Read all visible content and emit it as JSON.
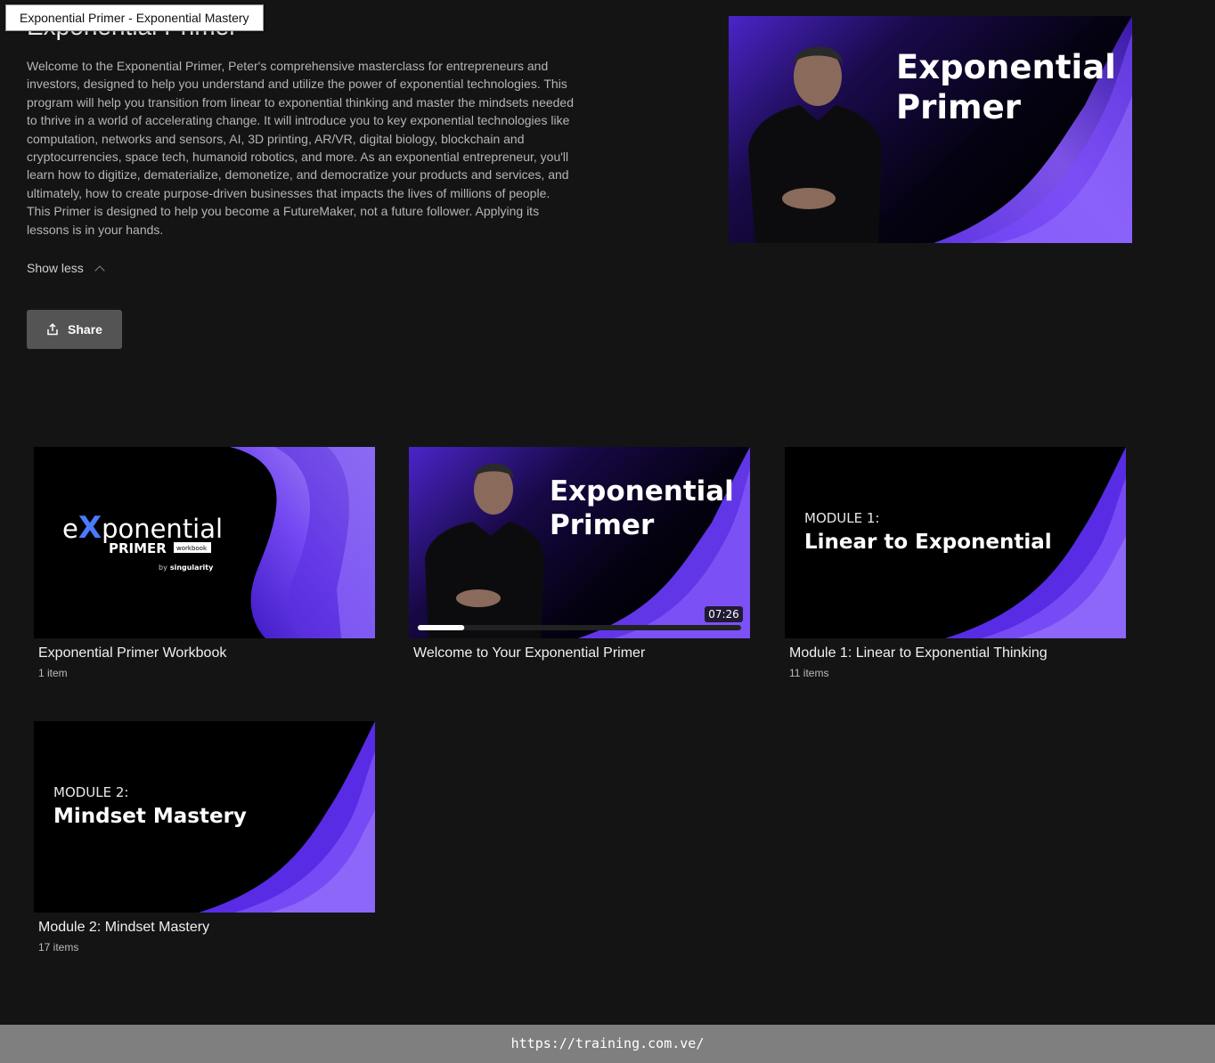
{
  "tooltip": "Exponential Primer - Exponential Mastery",
  "page_title": "Exponential Primer",
  "description": "Welcome to the Exponential Primer, Peter's comprehensive masterclass for entrepreneurs and investors, designed to help you understand and utilize the power of exponential technologies. This program will help you transition from linear to exponential thinking and master the mindsets needed to thrive in a world of accelerating change. It will introduce you to key exponential technologies like computation, networks and sensors, AI, 3D printing, AR/VR, digital biology, blockchain and cryptocurrencies, space tech, humanoid robotics, and more. As an exponential entrepreneur, you'll learn how to digitize, dematerialize, demonetize, and democratize your products and services, and ultimately, how to create purpose-driven businesses that impacts the lives of millions of people. This Primer is designed to help you become a FutureMaker, not a future follower. Applying its lessons is in your hands.",
  "show_less": "Show less",
  "share_label": "Share",
  "hero": {
    "line1": "Exponential",
    "line2": "Primer"
  },
  "cards": [
    {
      "title": "Exponential Primer Workbook",
      "subtitle": "1 item",
      "thumb": {
        "brand_e": "e",
        "brand_x": "X",
        "brand_rest": "ponential",
        "primer": "PRIMER",
        "workbook": "workbook",
        "by": "by",
        "singularity": "singularity"
      }
    },
    {
      "title": "Welcome to Your Exponential Primer",
      "duration": "07:26",
      "progress": 0.04,
      "thumb": {
        "line1": "Exponential",
        "line2": "Primer"
      }
    },
    {
      "title": "Module 1: Linear to Exponential Thinking",
      "subtitle": "11 items",
      "thumb": {
        "kicker": "MODULE 1:",
        "heading": "Linear to Exponential"
      }
    },
    {
      "title": "Module 2: Mindset Mastery",
      "subtitle": "17 items",
      "thumb": {
        "kicker": "MODULE 2:",
        "heading": "Mindset Mastery"
      }
    }
  ],
  "footer_url": "https://training.com.ve/",
  "colors": {
    "background": "#141414",
    "accent_purple": "#5b2ee8",
    "share_button": "#545454",
    "footer": "#7f7f7f"
  }
}
